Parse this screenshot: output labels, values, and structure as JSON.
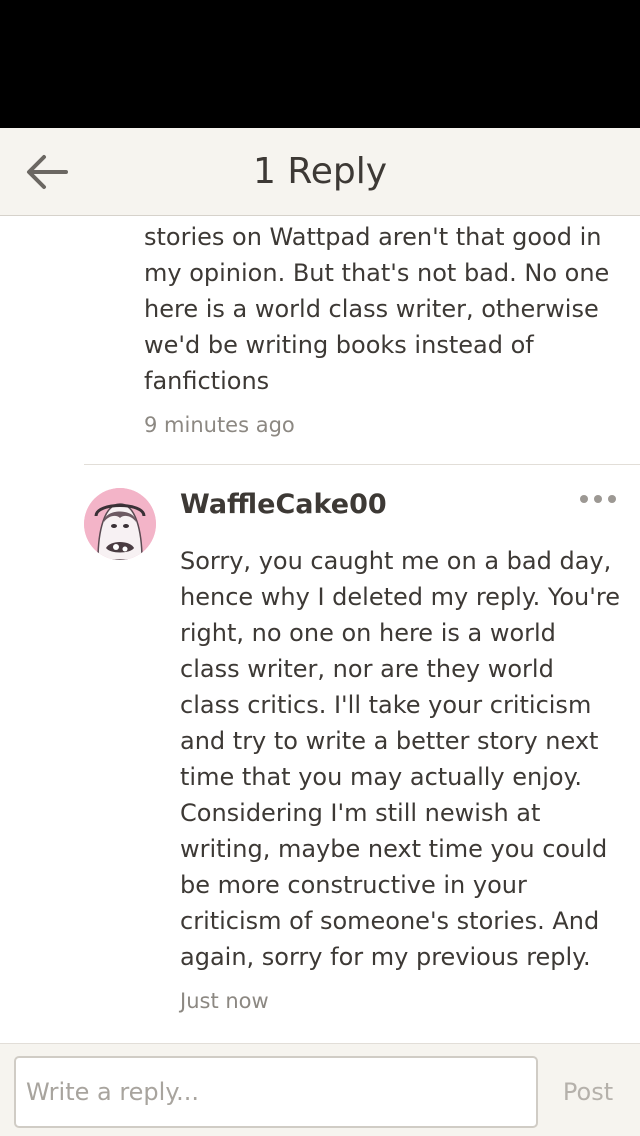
{
  "header": {
    "title": "1 Reply",
    "back_icon": "arrow-left-icon"
  },
  "comments": [
    {
      "text": "stories on Wattpad aren't that good in my opinion. But that's not bad. No one here is a world class writer, otherwise we'd be writing books instead of fanfictions",
      "time": "9 minutes ago"
    },
    {
      "username": "WaffleCake00",
      "avatar_icon": "user-avatar",
      "more_icon": "more-horizontal-icon",
      "text": "Sorry, you caught me on a bad day, hence why I deleted my reply. You're right, no one on here is a world class writer, nor are they world class critics. I'll take your criticism and try to write a better story next time that you may actually enjoy. Considering I'm still newish at writing, maybe next time you could be more constructive in your criticism of someone's stories. And again, sorry for my previous reply.",
      "time": "Just now"
    }
  ],
  "footer": {
    "input_placeholder": "Write a reply...",
    "post_label": "Post"
  },
  "colors": {
    "header_bg": "#f6f4ef",
    "text": "#3d3935",
    "muted": "#8c8882",
    "avatar_bg": "#f3b4c8"
  }
}
